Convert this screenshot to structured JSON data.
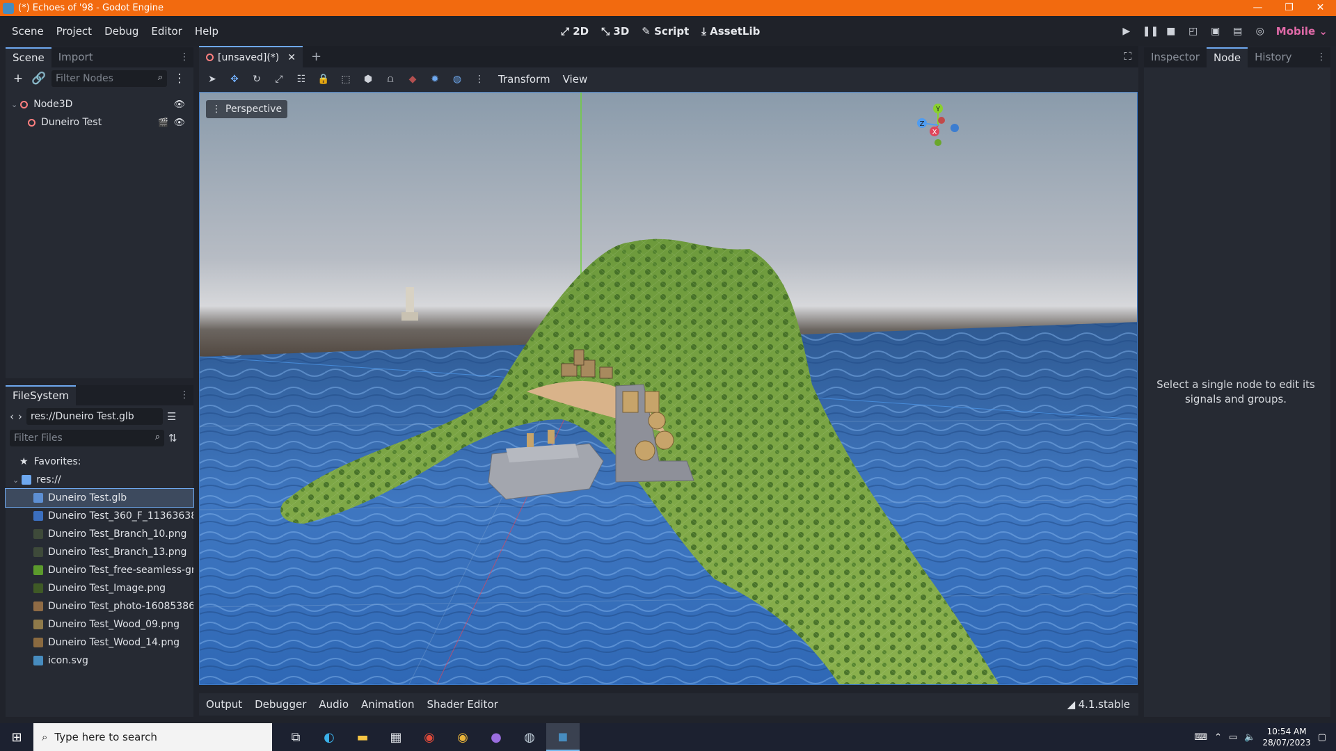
{
  "window": {
    "title": "(*) Echoes of '98 - Godot Engine",
    "controls": [
      "—",
      "❐",
      "✕"
    ]
  },
  "menu": [
    "Scene",
    "Project",
    "Debug",
    "Editor",
    "Help"
  ],
  "workspaces": [
    {
      "label": "2D",
      "icon": "2d-icon"
    },
    {
      "label": "3D",
      "icon": "3d-icon",
      "active": true
    },
    {
      "label": "Script",
      "icon": "script-icon"
    },
    {
      "label": "AssetLib",
      "icon": "assetlib-icon"
    }
  ],
  "run_bar": {
    "renderer": "Mobile"
  },
  "scene_dock": {
    "tabs": [
      "Scene",
      "Import"
    ],
    "filter_placeholder": "Filter Nodes",
    "nodes": [
      {
        "name": "Node3D"
      },
      {
        "name": "Duneiro Test"
      }
    ]
  },
  "filesystem": {
    "tab": "FileSystem",
    "path": "res://Duneiro Test.glb",
    "filter_placeholder": "Filter Files",
    "favorites": "Favorites:",
    "root": "res://",
    "files": [
      {
        "name": "Duneiro Test.glb",
        "color": "#5d8fd3",
        "selected": true
      },
      {
        "name": "Duneiro Test_360_F_113636383_",
        "color": "#3b6fbf"
      },
      {
        "name": "Duneiro Test_Branch_10.png",
        "color": "#3e4a3a"
      },
      {
        "name": "Duneiro Test_Branch_13.png",
        "color": "#3e4a3a"
      },
      {
        "name": "Duneiro Test_free-seamless-gras",
        "color": "#5b9a2c"
      },
      {
        "name": "Duneiro Test_Image.png",
        "color": "#3f5a26"
      },
      {
        "name": "Duneiro Test_photo-1608538620",
        "color": "#8f6b45"
      },
      {
        "name": "Duneiro Test_Wood_09.png",
        "color": "#8f7a4a"
      },
      {
        "name": "Duneiro Test_Wood_14.png",
        "color": "#8a6a40"
      },
      {
        "name": "icon.svg",
        "color": "#478cbf"
      }
    ]
  },
  "editor_tabs": {
    "scene_tab": "[unsaved](*)"
  },
  "viewport_toolbar": {
    "transform": "Transform",
    "view": "View"
  },
  "viewport": {
    "perspective_label": "Perspective",
    "gizmo_labels": {
      "y": "Y",
      "x": "X",
      "z": "Z"
    }
  },
  "bottom_panel": {
    "tabs": [
      "Output",
      "Debugger",
      "Audio",
      "Animation",
      "Shader Editor"
    ],
    "version": "4.1.stable"
  },
  "right_dock": {
    "tabs": [
      "Inspector",
      "Node",
      "History"
    ],
    "active": "Node",
    "message": "Select a single node to edit its signals and groups."
  },
  "taskbar": {
    "search_placeholder": "Type here to search",
    "time": "10:54 AM",
    "date": "28/07/2023"
  }
}
